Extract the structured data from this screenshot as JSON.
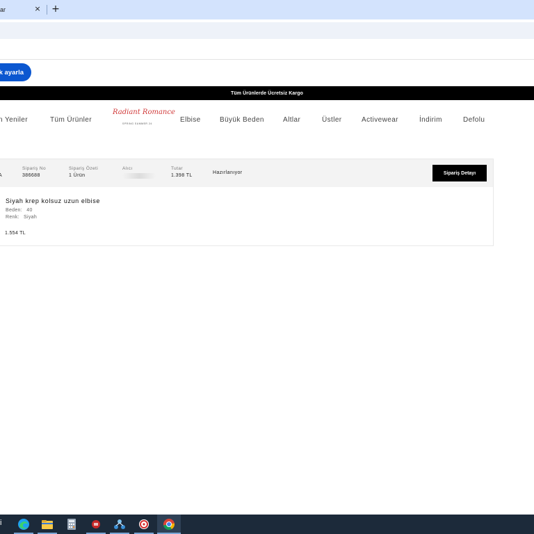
{
  "browser": {
    "tab_title": "ar",
    "tab_close": "×",
    "new_tab": "+"
  },
  "notification": {
    "button_label": "k ayarla"
  },
  "promo": {
    "text": "Tüm Ürünlerde Ücretsiz Kargo"
  },
  "nav": {
    "items": [
      "n Yeniler",
      "Tüm Ürünler",
      "Elbise",
      "Büyük Beden",
      "Altlar",
      "Üstler",
      "Activewear",
      "İndirim",
      "Defolu"
    ],
    "logo_text": "Radiant Romance",
    "logo_subtext": "SPRING SUMMER 24"
  },
  "order": {
    "partial_left_top": ")",
    "partial_left_bottom": "A",
    "order_no_label": "Sipariş No",
    "order_no_value": "386688",
    "summary_label": "Sipariş Özeti",
    "summary_value": "1 Ürün",
    "recipient_label": "Alıcı",
    "total_label": "Tutar",
    "total_value": "1.398 TL",
    "status": "Hazırlanıyor",
    "detail_button": "Sipariş Detayı",
    "product": {
      "name": "Siyah krep kolsuz uzun elbise",
      "size_label": "Beden:",
      "size_value": "40",
      "color_label": "Renk:",
      "color_value": "Siyah",
      "price": "1.554 TL"
    }
  },
  "taskbar": {
    "partial_text": "i",
    "icons": [
      "edge-icon",
      "file-explorer-icon",
      "calculator-icon",
      "red-app-icon",
      "network-app-icon",
      "red-circle-app-icon",
      "chrome-icon"
    ]
  }
}
